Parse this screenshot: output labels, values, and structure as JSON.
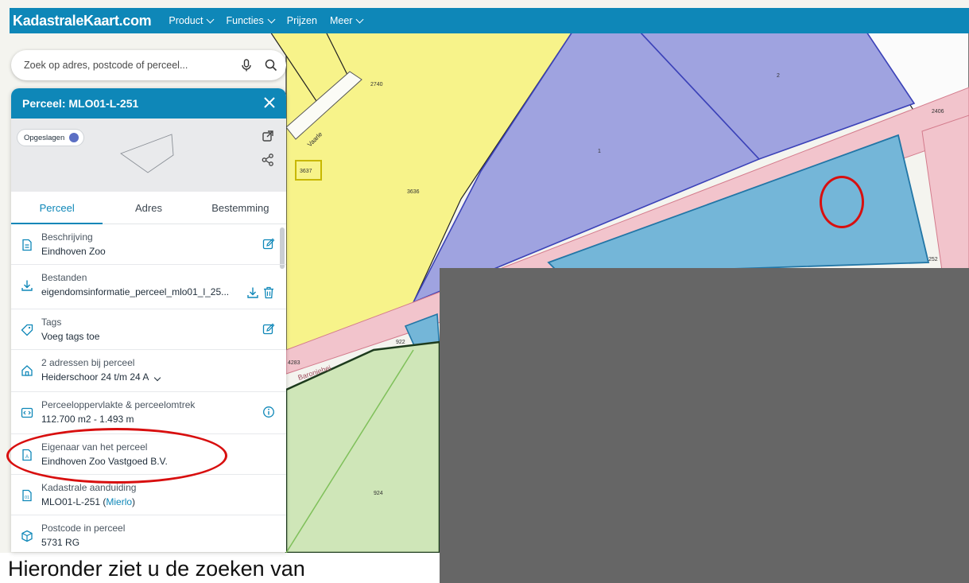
{
  "topbar": {
    "brand": "KadastraleKaart.com",
    "nav": [
      {
        "label": "Product",
        "dropdown": true
      },
      {
        "label": "Functies",
        "dropdown": true
      },
      {
        "label": "Prijzen",
        "dropdown": false
      },
      {
        "label": "Meer",
        "dropdown": true
      }
    ]
  },
  "search": {
    "placeholder": "Zoek op adres, postcode of perceel...",
    "icons": [
      "microphone-icon",
      "search-icon"
    ]
  },
  "panel": {
    "title": "Perceel: MLO01-L-251",
    "saved_label": "Opgeslagen",
    "tabs": [
      "Perceel",
      "Adres",
      "Bestemming"
    ],
    "active_tab": "Perceel",
    "rows": [
      {
        "label": "Beschrijving",
        "value": "Eindhoven Zoo",
        "icon": "document-icon",
        "action": "edit-icon"
      },
      {
        "label": "Bestanden",
        "value": "eigendomsinformatie_perceel_mlo01_l_25...",
        "icon": "download-icon",
        "action": "download-icon"
      },
      {
        "label": "Tags",
        "value": "Voeg tags toe",
        "icon": "tag-icon",
        "action": "edit-icon"
      },
      {
        "label": "2 adressen bij perceel",
        "value": "Heiderschoor 24 t/m 24 A",
        "icon": "home-icon",
        "action": ""
      },
      {
        "label": "Perceeloppervlakte & perceelomtrek",
        "value": "112.700 m2 - 1.493 m",
        "icon": "area-icon",
        "action": "info-icon"
      },
      {
        "label": "Eigenaar van het perceel",
        "value": "Eindhoven Zoo Vastgoed B.V.",
        "icon": "owner-icon",
        "action": ""
      },
      {
        "label": "Kadastrale aanduiding",
        "value_prefix": "MLO01-L-251 (",
        "value_link": "Mierlo",
        "value_suffix": ")",
        "icon": "cadastre-icon",
        "action": ""
      },
      {
        "label": "Postcode in perceel",
        "value": "5731 RG",
        "icon": "package-icon",
        "action": ""
      }
    ]
  },
  "map": {
    "labels": [
      "2740",
      "2",
      "1",
      "Vaarle",
      "3637",
      "3636",
      "2406",
      "252",
      "922",
      "4283",
      "Baroniehei",
      "924"
    ]
  },
  "footer": {
    "text": "Hieronder ziet u de zoeken van"
  },
  "colors": {
    "brand": "#0e87b8",
    "parcel_yellow": "#f7f38a",
    "parcel_purple": "#9fa3e0",
    "parcel_blue": "#74b6d8",
    "parcel_green": "#cfe6b8",
    "road_pink": "#f2c4cc",
    "annotation_red": "#d80f0f",
    "redaction_gray": "#666666"
  }
}
